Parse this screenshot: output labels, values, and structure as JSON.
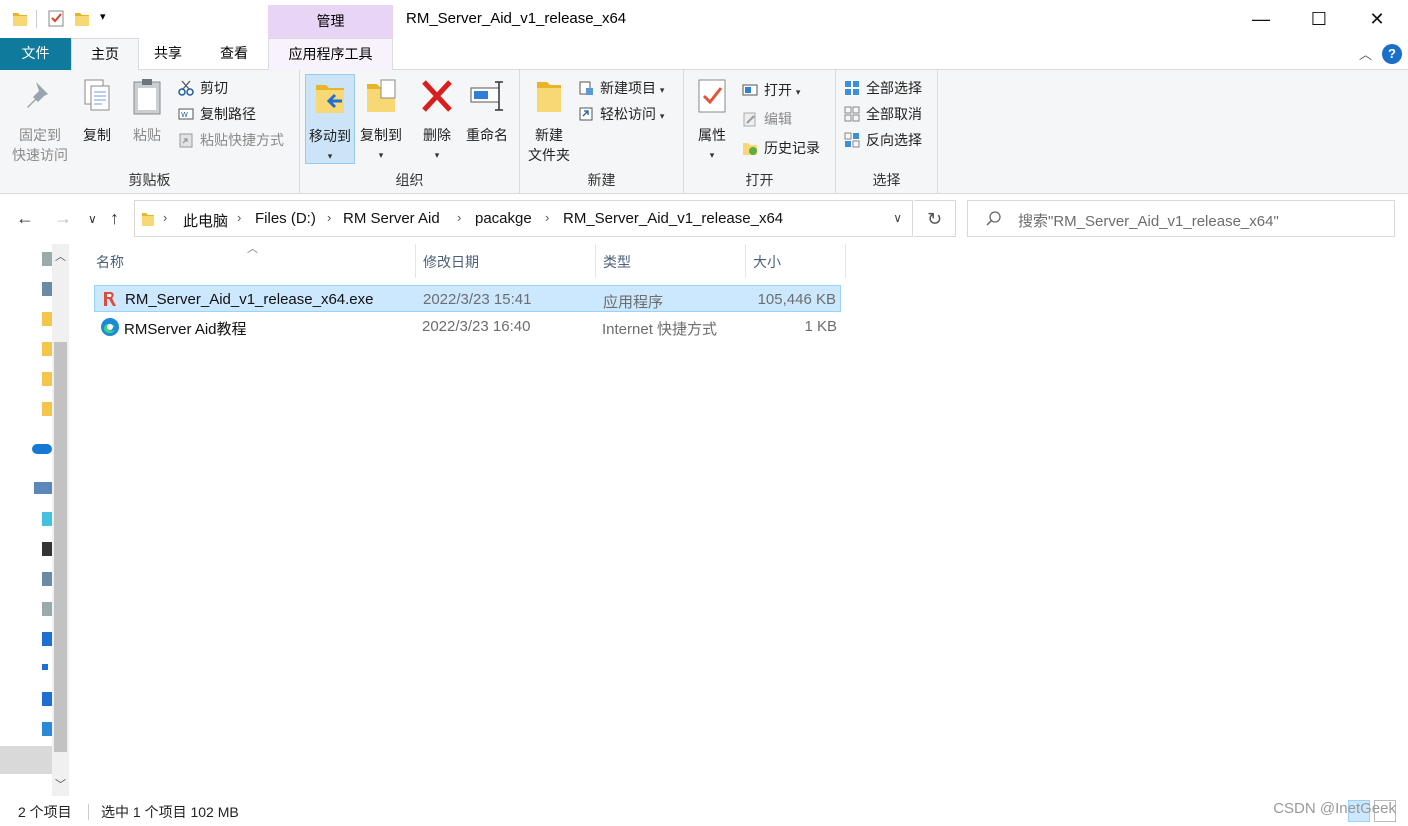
{
  "titlebar": {
    "window_title": "RM_Server_Aid_v1_release_x64",
    "context_tab": "管理",
    "minimize": "—",
    "maximize": "☐",
    "close": "✕"
  },
  "tabs": {
    "file": "文件",
    "home": "主页",
    "share": "共享",
    "view": "查看",
    "app_tools": "应用程序工具",
    "help": "?"
  },
  "ribbon": {
    "clipboard": {
      "label": "剪贴板",
      "pin_line1": "固定到",
      "pin_line2": "快速访问",
      "copy": "复制",
      "paste": "粘贴",
      "cut": "剪切",
      "copy_path": "复制路径",
      "paste_shortcut": "粘贴快捷方式"
    },
    "organize": {
      "label": "组织",
      "move_to": "移动到",
      "copy_to": "复制到",
      "delete": "删除",
      "rename": "重命名"
    },
    "new": {
      "label": "新建",
      "new_folder_line1": "新建",
      "new_folder_line2": "文件夹",
      "new_item": "新建项目",
      "easy_access": "轻松访问"
    },
    "open": {
      "label": "打开",
      "properties": "属性",
      "open": "打开",
      "edit": "编辑",
      "history": "历史记录"
    },
    "select": {
      "label": "选择",
      "select_all": "全部选择",
      "select_none": "全部取消",
      "invert": "反向选择"
    }
  },
  "address": {
    "crumbs": [
      "此电脑",
      "Files (D:)",
      "RM Server Aid",
      "pacakge",
      "RM_Server_Aid_v1_release_x64"
    ],
    "search_placeholder": "搜索\"RM_Server_Aid_v1_release_x64\""
  },
  "columns": {
    "name": "名称",
    "modified": "修改日期",
    "type": "类型",
    "size": "大小"
  },
  "files": [
    {
      "name": "RM_Server_Aid_v1_release_x64.exe",
      "modified": "2022/3/23 15:41",
      "type": "应用程序",
      "size": "105,446 KB",
      "selected": true,
      "icon": "app-exe-icon"
    },
    {
      "name": "RMServer Aid教程",
      "modified": "2022/3/23 16:40",
      "type": "Internet 快捷方式",
      "size": "1 KB",
      "selected": false,
      "icon": "edge-shortcut-icon"
    }
  ],
  "status": {
    "count": "2 个项目",
    "selection": "选中 1 个项目  102 MB",
    "watermark": "CSDN @InetGeek"
  },
  "colors": {
    "file_tab": "#0f7a9b",
    "context_tab": "#e8d5f5",
    "selection": "#cce8ff",
    "selection_border": "#99d1ff"
  }
}
